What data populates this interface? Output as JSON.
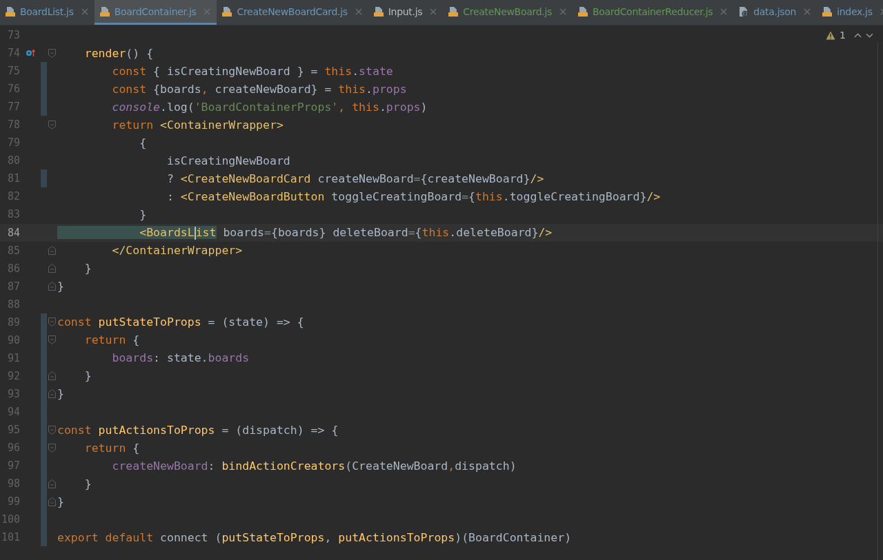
{
  "tabs": [
    {
      "label": "BoardList.js",
      "kind": "js",
      "selected": false,
      "color": "#6897bb"
    },
    {
      "label": "BoardContainer.js",
      "kind": "js",
      "selected": true,
      "color": "#6897bb"
    },
    {
      "label": "CreateNewBoardCard.js",
      "kind": "js",
      "selected": false,
      "color": "#6897bb"
    },
    {
      "label": "Input.js",
      "kind": "js",
      "selected": false,
      "color": "#bbbbbb"
    },
    {
      "label": "CreateNewBoard.js",
      "kind": "js",
      "selected": false,
      "color": "#629755"
    },
    {
      "label": "BoardContainerReducer.js",
      "kind": "js",
      "selected": false,
      "color": "#629755"
    },
    {
      "label": "data.json",
      "kind": "json",
      "selected": false,
      "color": "#6897bb"
    },
    {
      "label": "index.js",
      "kind": "js",
      "selected": false,
      "color": "#6897bb"
    }
  ],
  "inspection": {
    "warnings": "1"
  },
  "lines": [
    {
      "number": "73",
      "overridden": false,
      "fold_open": false,
      "fold_close": false,
      "changed": false,
      "current": false
    },
    {
      "number": "74",
      "overridden": true,
      "fold_open": true,
      "fold_close": false,
      "changed": false,
      "current": false,
      "tokens": [
        {
          "kind": "fn",
          "text": "    render"
        },
        {
          "kind": "plain",
          "text": "() {"
        }
      ]
    },
    {
      "number": "75",
      "overridden": false,
      "fold_open": false,
      "fold_close": false,
      "changed": true,
      "current": false,
      "tokens": [
        {
          "kind": "kw",
          "text": "        const"
        },
        {
          "kind": "plain",
          "text": " { isCreatingNewBoard } = "
        },
        {
          "kind": "kw",
          "text": "this"
        },
        {
          "kind": "plain",
          "text": "."
        },
        {
          "kind": "prop",
          "text": "state"
        }
      ]
    },
    {
      "number": "76",
      "overridden": false,
      "fold_open": false,
      "fold_close": false,
      "changed": true,
      "current": false,
      "tokens": [
        {
          "kind": "kw",
          "text": "        const"
        },
        {
          "kind": "plain",
          "text": " {boards"
        },
        {
          "kind": "kw",
          "text": ","
        },
        {
          "kind": "plain",
          "text": " createNewBoard} = "
        },
        {
          "kind": "kw",
          "text": "this"
        },
        {
          "kind": "plain",
          "text": "."
        },
        {
          "kind": "prop",
          "text": "props"
        }
      ]
    },
    {
      "number": "77",
      "overridden": false,
      "fold_open": false,
      "fold_close": false,
      "changed": true,
      "current": false,
      "tokens": [
        {
          "kind": "global",
          "text": "        console"
        },
        {
          "kind": "plain",
          "text": ".log("
        },
        {
          "kind": "str",
          "text": "'BoardContainerProps'"
        },
        {
          "kind": "kw",
          "text": ","
        },
        {
          "kind": "kw",
          "text": " this"
        },
        {
          "kind": "plain",
          "text": "."
        },
        {
          "kind": "prop",
          "text": "props"
        },
        {
          "kind": "plain",
          "text": ")"
        }
      ]
    },
    {
      "number": "78",
      "overridden": false,
      "fold_open": true,
      "fold_close": false,
      "changed": false,
      "current": false,
      "tokens": [
        {
          "kind": "kw",
          "text": "        return "
        },
        {
          "kind": "tag",
          "text": "<ContainerWrapper>"
        }
      ]
    },
    {
      "number": "79",
      "overridden": false,
      "fold_open": false,
      "fold_close": false,
      "changed": false,
      "current": false,
      "tokens": [
        {
          "kind": "plain",
          "text": "            {"
        }
      ]
    },
    {
      "number": "80",
      "overridden": false,
      "fold_open": false,
      "fold_close": false,
      "changed": false,
      "current": false,
      "tokens": [
        {
          "kind": "plain",
          "text": "                isCreatingNewBoard"
        }
      ]
    },
    {
      "number": "81",
      "overridden": false,
      "fold_open": false,
      "fold_close": false,
      "changed": true,
      "current": false,
      "tokens": [
        {
          "kind": "plain",
          "text": "                ? "
        },
        {
          "kind": "tag",
          "text": "<CreateNewBoardCard"
        },
        {
          "kind": "plain",
          "text": " createNewBoard"
        },
        {
          "kind": "op",
          "text": "="
        },
        {
          "kind": "plain",
          "text": "{createNewBoard}"
        },
        {
          "kind": "tag",
          "text": "/>"
        }
      ]
    },
    {
      "number": "82",
      "overridden": false,
      "fold_open": false,
      "fold_close": false,
      "changed": false,
      "current": false,
      "tokens": [
        {
          "kind": "plain",
          "text": "                : "
        },
        {
          "kind": "tag",
          "text": "<CreateNewBoardButton"
        },
        {
          "kind": "plain",
          "text": " toggleCreatingBoard"
        },
        {
          "kind": "op",
          "text": "="
        },
        {
          "kind": "plain",
          "text": "{"
        },
        {
          "kind": "kw",
          "text": "this"
        },
        {
          "kind": "plain",
          "text": ".toggleCreatingBoard}"
        },
        {
          "kind": "tag",
          "text": "/>"
        }
      ]
    },
    {
      "number": "83",
      "overridden": false,
      "fold_open": false,
      "fold_close": false,
      "changed": false,
      "current": false,
      "tokens": [
        {
          "kind": "plain",
          "text": "            }"
        }
      ]
    },
    {
      "number": "84",
      "overridden": false,
      "fold_open": false,
      "fold_close": false,
      "changed": false,
      "current": true,
      "tokens": [
        {
          "kind": "match",
          "text": "            <BoardsL",
          "caret_after": true
        },
        {
          "kind": "match",
          "text": "ist"
        },
        {
          "kind": "plain",
          "text": " boards"
        },
        {
          "kind": "op",
          "text": "="
        },
        {
          "kind": "plain",
          "text": "{boards} deleteBoard"
        },
        {
          "kind": "op",
          "text": "="
        },
        {
          "kind": "plain",
          "text": "{"
        },
        {
          "kind": "kw",
          "text": "this"
        },
        {
          "kind": "plain",
          "text": ".deleteBoard}"
        },
        {
          "kind": "tag",
          "text": "/>"
        }
      ]
    },
    {
      "number": "85",
      "overridden": false,
      "fold_open": false,
      "fold_close": true,
      "changed": false,
      "current": false,
      "tokens": [
        {
          "kind": "tag",
          "text": "        </ContainerWrapper>"
        }
      ]
    },
    {
      "number": "86",
      "overridden": false,
      "fold_open": false,
      "fold_close": true,
      "changed": false,
      "current": false,
      "tokens": [
        {
          "kind": "plain",
          "text": "    }"
        }
      ]
    },
    {
      "number": "87",
      "overridden": false,
      "fold_open": false,
      "fold_close": true,
      "changed": false,
      "current": false,
      "tokens": [
        {
          "kind": "plain",
          "text": "}"
        }
      ]
    },
    {
      "number": "88",
      "overridden": false,
      "fold_open": false,
      "fold_close": false,
      "changed": false,
      "current": false
    },
    {
      "number": "89",
      "overridden": false,
      "fold_open": true,
      "fold_close": false,
      "changed": true,
      "current": false,
      "tokens": [
        {
          "kind": "kw",
          "text": "const "
        },
        {
          "kind": "fn",
          "text": "putStateToProps"
        },
        {
          "kind": "plain",
          "text": " = (state) => {"
        }
      ]
    },
    {
      "number": "90",
      "overridden": false,
      "fold_open": true,
      "fold_close": false,
      "changed": true,
      "current": false,
      "tokens": [
        {
          "kind": "kw",
          "text": "    return"
        },
        {
          "kind": "plain",
          "text": " {"
        }
      ]
    },
    {
      "number": "91",
      "overridden": false,
      "fold_open": false,
      "fold_close": false,
      "changed": true,
      "current": false,
      "tokens": [
        {
          "kind": "prop",
          "text": "        boards"
        },
        {
          "kind": "plain",
          "text": ": state."
        },
        {
          "kind": "prop",
          "text": "boards"
        }
      ]
    },
    {
      "number": "92",
      "overridden": false,
      "fold_open": false,
      "fold_close": true,
      "changed": true,
      "current": false,
      "tokens": [
        {
          "kind": "plain",
          "text": "    }"
        }
      ]
    },
    {
      "number": "93",
      "overridden": false,
      "fold_open": false,
      "fold_close": true,
      "changed": true,
      "current": false,
      "tokens": [
        {
          "kind": "plain",
          "text": "}"
        }
      ]
    },
    {
      "number": "94",
      "overridden": false,
      "fold_open": false,
      "fold_close": false,
      "changed": true,
      "current": false
    },
    {
      "number": "95",
      "overridden": false,
      "fold_open": true,
      "fold_close": false,
      "changed": true,
      "current": false,
      "tokens": [
        {
          "kind": "kw",
          "text": "const "
        },
        {
          "kind": "fn",
          "text": "putActionsToProps"
        },
        {
          "kind": "plain",
          "text": " = (dispatch) => {"
        }
      ]
    },
    {
      "number": "96",
      "overridden": false,
      "fold_open": true,
      "fold_close": false,
      "changed": true,
      "current": false,
      "tokens": [
        {
          "kind": "kw",
          "text": "    return"
        },
        {
          "kind": "plain",
          "text": " {"
        }
      ]
    },
    {
      "number": "97",
      "overridden": false,
      "fold_open": false,
      "fold_close": false,
      "changed": true,
      "current": false,
      "tokens": [
        {
          "kind": "prop",
          "text": "        createNewBoard"
        },
        {
          "kind": "plain",
          "text": ": "
        },
        {
          "kind": "fn",
          "text": "bindActionCreators"
        },
        {
          "kind": "plain",
          "text": "(CreateNewBoard"
        },
        {
          "kind": "kw",
          "text": ","
        },
        {
          "kind": "plain",
          "text": "dispatch)"
        }
      ]
    },
    {
      "number": "98",
      "overridden": false,
      "fold_open": false,
      "fold_close": true,
      "changed": true,
      "current": false,
      "tokens": [
        {
          "kind": "plain",
          "text": "    }"
        }
      ]
    },
    {
      "number": "99",
      "overridden": false,
      "fold_open": false,
      "fold_close": true,
      "changed": true,
      "current": false,
      "tokens": [
        {
          "kind": "plain",
          "text": "}"
        }
      ]
    },
    {
      "number": "100",
      "overridden": false,
      "fold_open": false,
      "fold_close": false,
      "changed": true,
      "current": false
    },
    {
      "number": "101",
      "overridden": false,
      "fold_open": false,
      "fold_close": false,
      "changed": true,
      "current": false,
      "tokens": [
        {
          "kind": "kw",
          "text": "export default"
        },
        {
          "kind": "plain",
          "text": " connect ("
        },
        {
          "kind": "fn",
          "text": "putStateToProps"
        },
        {
          "kind": "plain",
          "text": ", "
        },
        {
          "kind": "fn",
          "text": "putActionsToProps"
        },
        {
          "kind": "plain",
          "text": ")(BoardContainer)"
        }
      ]
    }
  ]
}
